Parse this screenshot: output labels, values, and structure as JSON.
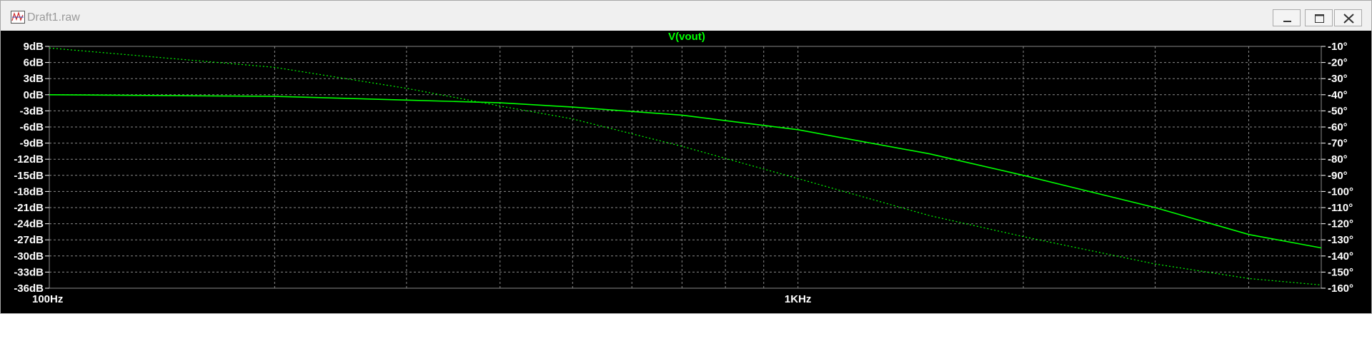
{
  "window": {
    "title": "Draft1.raw",
    "controls": [
      "minimize",
      "maximize",
      "close"
    ]
  },
  "plot": {
    "trace_label": "V(vout)",
    "left_axis_ticks": [
      "9dB",
      "6dB",
      "3dB",
      "0dB",
      "-3dB",
      "-6dB",
      "-9dB",
      "-12dB",
      "-15dB",
      "-18dB",
      "-21dB",
      "-24dB",
      "-27dB",
      "-30dB",
      "-33dB",
      "-36dB"
    ],
    "right_axis_ticks": [
      "-10°",
      "-20°",
      "-30°",
      "-40°",
      "-50°",
      "-60°",
      "-70°",
      "-80°",
      "-90°",
      "-100°",
      "-110°",
      "-120°",
      "-130°",
      "-140°",
      "-150°",
      "-160°"
    ],
    "x_axis_ticks": [
      "100Hz",
      "1KHz"
    ],
    "colors": {
      "background": "#000000",
      "trace": "#00ff00",
      "grid": "#8a8a8a",
      "labels": "#ffffff"
    }
  },
  "chart_data": {
    "type": "line",
    "title": "V(vout)",
    "x_scale": "log",
    "xlim": [
      100,
      5000
    ],
    "ylim_left": [
      -36,
      9
    ],
    "ylim_right": [
      -160,
      -10
    ],
    "grid": true,
    "series": [
      {
        "axis": "left",
        "style": "solid",
        "x": [
          100,
          200,
          300,
          400,
          500,
          700,
          1000,
          1500,
          2000,
          3000,
          4000,
          5000
        ],
        "y": [
          0,
          -0.3,
          -1.0,
          -1.5,
          -2.3,
          -3.8,
          -6.5,
          -11,
          -15,
          -21,
          -26,
          -28.5
        ]
      },
      {
        "axis": "right",
        "style": "dashed",
        "x": [
          100,
          200,
          300,
          400,
          500,
          700,
          1000,
          1500,
          2000,
          3000,
          4000,
          5000
        ],
        "y": [
          -11,
          -23,
          -36,
          -47,
          -55,
          -72,
          -92,
          -115,
          -128,
          -145,
          -154,
          -158
        ]
      }
    ]
  }
}
